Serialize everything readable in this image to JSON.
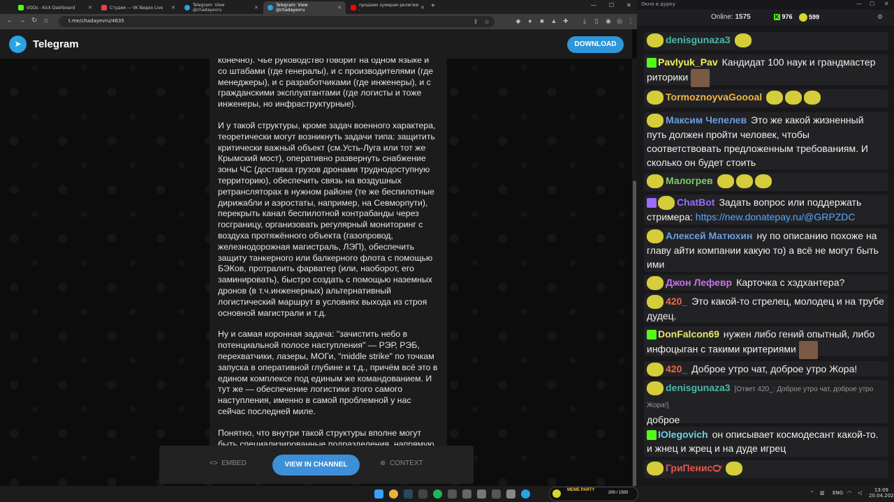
{
  "browser": {
    "tabs": [
      {
        "title": "VODs - Kick Dashboard",
        "color": "#53fc18"
      },
      {
        "title": "Студия — VK Видео Live",
        "color": "#e2414b"
      },
      {
        "title": "Telegram: View @chadayevru",
        "color": "#2aa3e6"
      },
      {
        "title": "Telegram: View @chadayevru",
        "color": "#2aa3e6",
        "active": true
      },
      {
        "title": "продаем зумерам религию - ",
        "color": "#ff0000"
      }
    ],
    "url": "t.me/chadayevru/4635"
  },
  "telegram": {
    "brand": "Telegram",
    "download_label": "DOWNLOAD",
    "paragraphs": [
      "конечно). Чье руководство говорит на одном языке и со штабами (где генералы), и с производителями (где менеджеры), и с разработчиками (где инженеры), и с гражданскими эксплуатантами (где логисты и тоже инженеры, но инфраструктурные).",
      "И у такой структуры, кроме задач военного характера, теоретически могут возникнуть задачи типа: защитить критически важный объект (см.Усть-Луга или тот же Крымский мост), оперативно развернуть снабжение зоны ЧС (доставка грузов дронами труднодоступную территорию), обеспечить связь на воздушных ретрансляторах в нужном районе (те же беспилотные дирижабли и аэростаты, например, на Севморпути), перекрыть канал беспилотной контрабанды через госграницу, организовать регулярный мониторинг с воздуха протяжённого объекта (газопровод, железнодорожная магистраль, ЛЭП), обеспечить защиту танкерного или балкерного флота с помощью БЭКов, протралить фарватер (или, наоборот, его заминировать), быстро создать с помощью наземных дронов (в т.ч.инженерных) альтернативный логистический маршрут в условиях выхода из строя основной магистрали и т.д.",
      "Ну и самая коронная задача: \"зачистить небо в потенциальной полосе наступления\" — РЭР, РЭБ, перехватчики, лазеры, МОГи, \"middle strike\" по точкам запуска в оперативной глубине и т.д., причём всё это в едином комплексе под единым же командованием. И тут же — обеспечение логистики этого самого наступления, именно в самой проблемной у нас сейчас последней миле.",
      "Понятно, что внутри такой структуры вполне могут быть специализированные подразделения, напрямую"
    ],
    "embed_label": "EMBED",
    "view_label": "VIEW IN CHANNEL",
    "context_label": "CONTEXT"
  },
  "chat": {
    "window_title": "Окно в дурку",
    "online_label": "Online:",
    "online_count": "1575",
    "kick_count": "976",
    "other_count": "599",
    "messages": [
      {
        "user": "denisgunaza3",
        "color": "#4cb8a8",
        "text": ""
      },
      {
        "user": "Pavlyuk_Pav",
        "color": "#f2f25e",
        "text": "Кандидат 100 наук и грандмастер риторики"
      },
      {
        "user": "TormoznoyvaGoooal",
        "color": "#f0b73e",
        "text": ""
      },
      {
        "user": "Максим Чепелев",
        "color": "#6b9fe0",
        "text": "Это же какой жизненный путь должен пройти человек, чтобы соответствовать предложенным требованиям. И сколько он будет стоить"
      },
      {
        "user": "Малогрев",
        "color": "#7ec96b",
        "text": ""
      },
      {
        "user": "ChatBot",
        "color": "#9a6cff",
        "text": "Задать вопрос или поддержать стримера: ",
        "link": "https://new.donatepay.ru/@GRPZDC"
      },
      {
        "user": "Алексей Матюхин",
        "color": "#6b9fe0",
        "text": "ну по описанию похоже на главу айти компании какую то) а всё не могут быть ими"
      },
      {
        "user": "Джон Лефевр",
        "color": "#c772e8",
        "text": "Карточка с хэдхантера?"
      },
      {
        "user": "420_",
        "color": "#e86a4a",
        "text": "Это какой-то стрелец, молодец и на трубе дудец."
      },
      {
        "user": "DonFalcon69",
        "color": "#e8e86a",
        "text": "нужен либо гений опытный, либо инфоцыган с такими критериями"
      },
      {
        "user": "420_",
        "color": "#e86a4a",
        "text": "Доброе утро чат, доброе утро Жора!"
      },
      {
        "user": "denisgunaza3",
        "color": "#4cb8a8",
        "reply": "[Ответ 420_: Доброе утро чат, доброе утро Жора!]",
        "text": "доброе"
      },
      {
        "user": "IOlegovich",
        "color": "#6bd0e0",
        "text": "он описывает космодесант какой-то. и жнец и жрец и на дуде игрец"
      },
      {
        "user": "ГриПенис℺",
        "color": "#e8554a",
        "text": ""
      }
    ]
  },
  "taskbar": {
    "lang": "ENG",
    "time": "13:09",
    "date": "20.04.2026",
    "meme_label": "MEME PARTY",
    "meme_value": "200 / 1500"
  }
}
